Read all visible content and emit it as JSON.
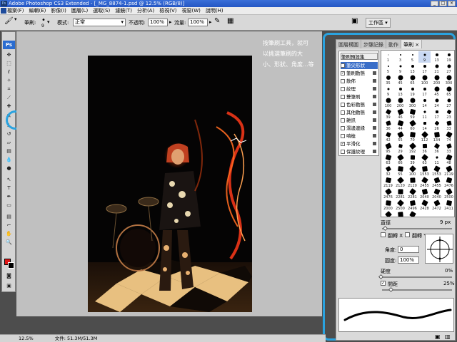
{
  "window": {
    "title": "Adobe Photoshop CS3 Extended - [_MG_8874-1.psd @ 12.5% (RGB/8)]",
    "minimize": "_",
    "maximize": "□",
    "close": "×"
  },
  "menu": [
    "檔案(F)",
    "編輯(E)",
    "影像(I)",
    "圖層(L)",
    "選取(S)",
    "濾鏡(T)",
    "分析(A)",
    "檢視(V)",
    "視窗(W)",
    "說明(H)"
  ],
  "options": {
    "brush_label": "筆刷:",
    "brush_size": "9",
    "mode_label": "模式:",
    "mode_value": "正常",
    "opacity_label": "不透明:",
    "opacity_value": "100%",
    "flow_label": "流量:",
    "flow_value": "100%",
    "workspace_label": "工作區 ▾"
  },
  "annotation": {
    "line1": "按筆刷工具，就可",
    "line2": "以挑選筆刷的大",
    "line3": "小、形狀、角度...等"
  },
  "panel": {
    "tabs": [
      "圖層構圖",
      "步驟記錄",
      "動作",
      "筆刷 ×"
    ],
    "preset_title": "筆刷預設集",
    "settings": [
      {
        "label": "筆尖形狀",
        "checked": false,
        "selected": true
      },
      {
        "label": "筆刷動態",
        "checked": true,
        "selected": false
      },
      {
        "label": "散佈",
        "checked": false,
        "selected": false
      },
      {
        "label": "紋理",
        "checked": false,
        "selected": false
      },
      {
        "label": "雙筆刷",
        "checked": false,
        "selected": false
      },
      {
        "label": "色彩動態",
        "checked": false,
        "selected": false
      },
      {
        "label": "其他動態",
        "checked": false,
        "selected": false
      },
      {
        "label": "雜訊",
        "checked": false,
        "selected": false
      },
      {
        "label": "濕邊邊緣",
        "checked": false,
        "selected": false
      },
      {
        "label": "噴槍",
        "checked": false,
        "selected": false
      },
      {
        "label": "平滑化",
        "checked": true,
        "selected": false
      },
      {
        "label": "保護紋理",
        "checked": false,
        "selected": false
      }
    ],
    "brush_sizes": [
      "1",
      "3",
      "5",
      "9",
      "13",
      "19",
      "5",
      "9",
      "13",
      "17",
      "21",
      "27",
      "35",
      "45",
      "65",
      "100",
      "200",
      "300",
      "9",
      "13",
      "19",
      "17",
      "45",
      "65",
      "100",
      "200",
      "300",
      "14",
      "24",
      "27",
      "39",
      "46",
      "59",
      "11",
      "17",
      "23",
      "36",
      "44",
      "60",
      "14",
      "26",
      "33",
      "42",
      "55",
      "70",
      "112",
      "134",
      "74",
      "95",
      "29",
      "192",
      "36",
      "36",
      "33",
      "63",
      "66",
      "39",
      "63",
      "11",
      "48",
      "32",
      "55",
      "100",
      "1553",
      "1553",
      "2119",
      "2119",
      "2120",
      "2120",
      "2455",
      "2455",
      "2476",
      "2476",
      "2281",
      "2281",
      "2040",
      "2040",
      "2500",
      "2000",
      "2500",
      "2496",
      "2428",
      "2472",
      "2411",
      "2500",
      "2500",
      "2339"
    ],
    "diameter_label": "直徑",
    "diameter_value": "9 px",
    "flip_x_label": "翻轉 X",
    "flip_y_label": "翻轉 Y",
    "angle_label": "角度:",
    "angle_value": "0",
    "roundness_label": "圓度:",
    "roundness_value": "100%",
    "hardness_label": "硬度",
    "hardness_value": "0%",
    "spacing_label": "間距",
    "spacing_value": "25%"
  },
  "status": {
    "zoom": "12.5%",
    "doc": "文件: 51.3M/51.3M"
  },
  "colors": {
    "accent_highlight": "#2aa3e0",
    "foreground": "#e01515",
    "background": "#000000"
  }
}
